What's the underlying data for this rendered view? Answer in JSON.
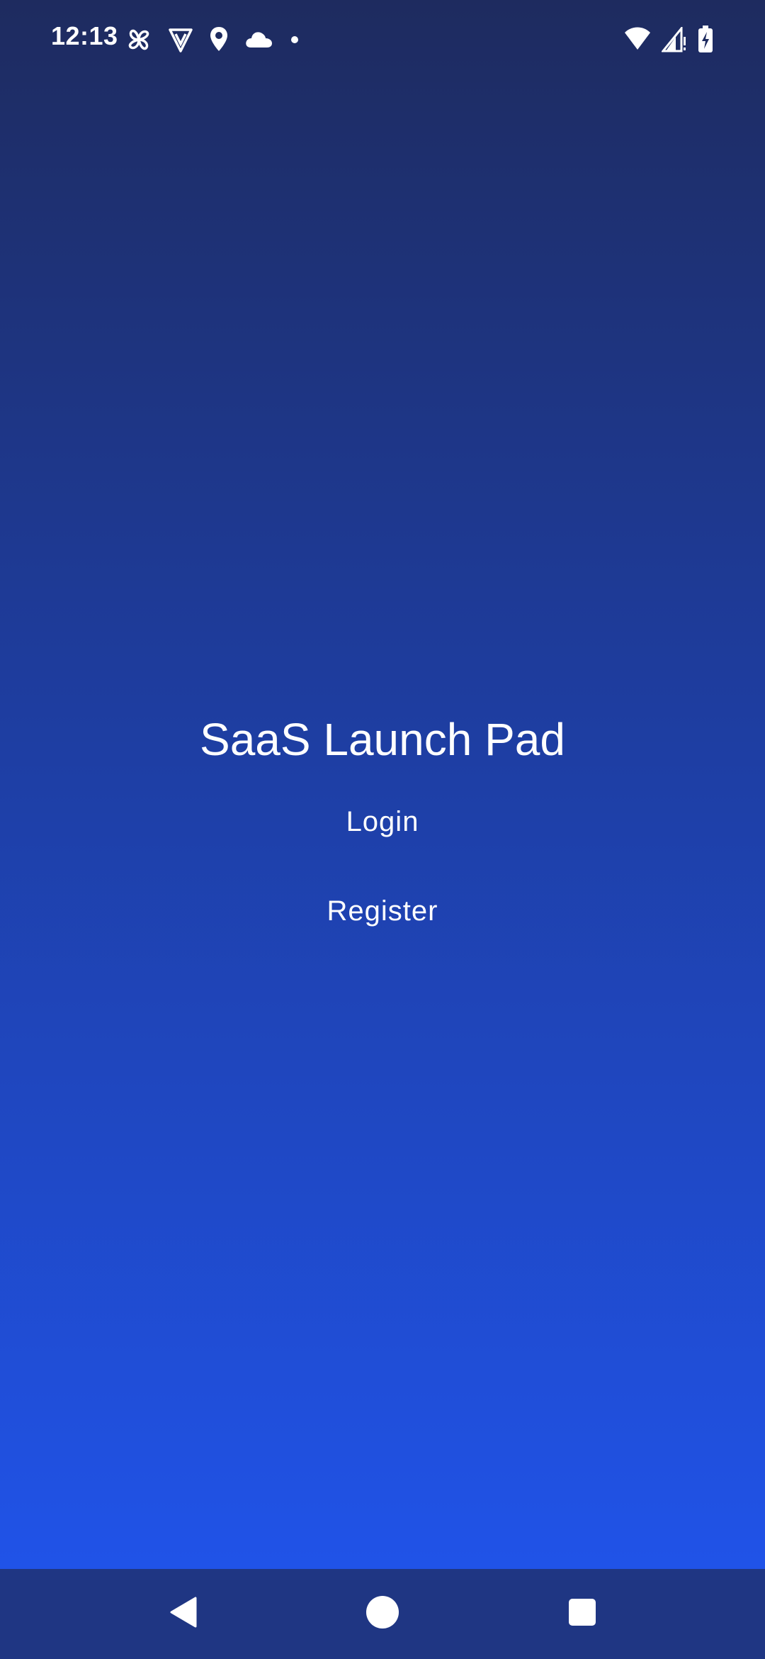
{
  "status_bar": {
    "time": "12:13",
    "left_icons": [
      "pinwheel-icon",
      "shield-v-icon",
      "location-pin-icon",
      "cloud-icon",
      "dot-icon"
    ],
    "right_icons": [
      "wifi-icon",
      "cellular-signal-icon",
      "battery-charging-icon"
    ]
  },
  "main": {
    "title": "SaaS Launch Pad",
    "login_label": "Login",
    "register_label": "Register"
  },
  "nav_bar": {
    "buttons": [
      "back-icon",
      "home-icon",
      "recents-icon"
    ]
  },
  "colors": {
    "gradient_top": "#1e2b5f",
    "gradient_mid": "#1e3b99",
    "gradient_bottom": "#2053e8",
    "nav_bar": "#1f3683",
    "text": "#ffffff"
  }
}
